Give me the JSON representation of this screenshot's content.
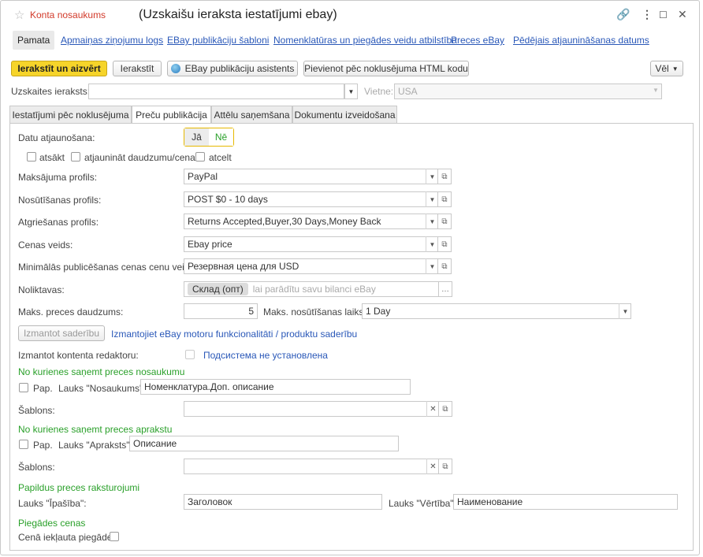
{
  "header": {
    "konta": "Konta nosaukums",
    "title": "(Uzskaišu ieraksta iestatījumi ebay)"
  },
  "nav": {
    "items": [
      "Pamata",
      "Apmaiņas ziņojumu logs",
      "EBay publikāciju šabloni",
      "Nomenklatūras un piegādes veidu atbilstība",
      "Preces eBay",
      "Pēdējais atjaunināšanas datums"
    ]
  },
  "toolbar": {
    "save_close": "Ierakstīt un aizvērt",
    "save": "Ierakstīt",
    "assistant": "EBay publikāciju asistents",
    "add_html": "Pievienot pēc noklusējuma HTML kodu",
    "more": "Vēl"
  },
  "record": {
    "label": "Uzskaites ieraksts:",
    "value": "",
    "site_label": "Vietne:",
    "site_value": "USA"
  },
  "tabs": [
    "Iestatījumi pēc noklusējuma",
    "Preču publikācija",
    "Attēlu saņemšana",
    "Dokumentu izveidošana"
  ],
  "form": {
    "update_label": "Datu atjaunošana:",
    "yes": "Jā",
    "no": "Nē",
    "cb_start": "atsākt",
    "cb_update_qty": "atjaunināt daudzumu/cenas",
    "cb_cancel": "atcelt",
    "payment_label": "Maksājuma profils:",
    "payment_value": "PayPal",
    "shipping_label": "Nosūtīšanas profils:",
    "shipping_value": "POST $0 - 10 days",
    "return_label": "Atgriešanas profils:",
    "return_value": "Returns Accepted,Buyer,30 Days,Money Back",
    "price_type_label": "Cenas veids:",
    "price_type_value": "Ebay price",
    "min_price_label": "Minimālās publicēšanas cenas cenu veids:",
    "min_price_value": "Резервная цена для USD",
    "warehouse_label": "Noliktavas:",
    "warehouse_chip": "Склад (опт)",
    "warehouse_hint": "lai parādītu savu bilanci eBay",
    "max_qty_label": "Maks. preces daudzums:",
    "max_qty_value": "5",
    "max_ship_label": "Maks. nosūtīšanas laiks:",
    "max_ship_value": "1 Day",
    "compat_btn": "Izmantot saderību",
    "compat_link": "Izmantojiet eBay motoru funkcionalitāti / produktu saderību",
    "editor_label": "Izmantot kontenta redaktoru:",
    "editor_note": "Подсистема не установлена",
    "sec_name": "No kurienes saņemt preces nosaukumu",
    "pap1": "Pap.",
    "field_name_label": "Lauks \"Nosaukums\":",
    "field_name_value": "Номенклатура.Доп. описание",
    "template_label": "Šablons:",
    "sec_desc": "No kurienes saņemt preces aprakstu",
    "pap2": "Pap.",
    "field_desc_label": "Lauks \"Apraksts\":",
    "field_desc_value": "Описание",
    "template2_label": "Šablons:",
    "sec_attrs": "Papildus preces raksturojumi",
    "prop_label": "Lauks \"Īpašība\":",
    "prop_value": "Заголовок",
    "val_label": "Lauks \"Vērtība\":",
    "val_value": "Наименование",
    "sec_ship": "Piegādes cenas",
    "ship_incl_label": "Cenā iekļauta piegāde:"
  }
}
